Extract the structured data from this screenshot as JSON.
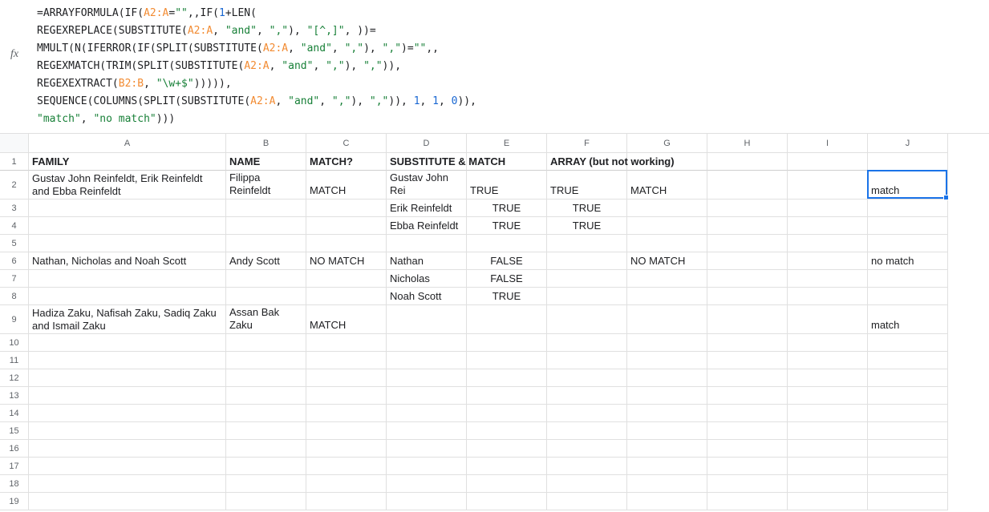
{
  "formula_lines": [
    [
      {
        "t": "punc",
        "v": "="
      },
      {
        "t": "func",
        "v": "ARRAYFORMULA"
      },
      {
        "t": "punc",
        "v": "("
      },
      {
        "t": "func",
        "v": "IF"
      },
      {
        "t": "punc",
        "v": "("
      },
      {
        "t": "range",
        "v": "A2:A"
      },
      {
        "t": "punc",
        "v": "="
      },
      {
        "t": "str",
        "v": "\"\""
      },
      {
        "t": "punc",
        "v": ",,"
      },
      {
        "t": "func",
        "v": "IF"
      },
      {
        "t": "punc",
        "v": "("
      },
      {
        "t": "num",
        "v": "1"
      },
      {
        "t": "punc",
        "v": "+"
      },
      {
        "t": "func",
        "v": "LEN"
      },
      {
        "t": "punc",
        "v": "("
      }
    ],
    [
      {
        "t": "func",
        "v": "REGEXREPLACE"
      },
      {
        "t": "punc",
        "v": "("
      },
      {
        "t": "func",
        "v": "SUBSTITUTE"
      },
      {
        "t": "punc",
        "v": "("
      },
      {
        "t": "range",
        "v": "A2:A"
      },
      {
        "t": "punc",
        "v": ", "
      },
      {
        "t": "str",
        "v": "\"and\""
      },
      {
        "t": "punc",
        "v": ", "
      },
      {
        "t": "str",
        "v": "\",\""
      },
      {
        "t": "punc",
        "v": "), "
      },
      {
        "t": "str",
        "v": "\"[^,]\""
      },
      {
        "t": "punc",
        "v": ", ))="
      }
    ],
    [
      {
        "t": "func",
        "v": "MMULT"
      },
      {
        "t": "punc",
        "v": "("
      },
      {
        "t": "func",
        "v": "N"
      },
      {
        "t": "punc",
        "v": "("
      },
      {
        "t": "func",
        "v": "IFERROR"
      },
      {
        "t": "punc",
        "v": "("
      },
      {
        "t": "func",
        "v": "IF"
      },
      {
        "t": "punc",
        "v": "("
      },
      {
        "t": "func",
        "v": "SPLIT"
      },
      {
        "t": "punc",
        "v": "("
      },
      {
        "t": "func",
        "v": "SUBSTITUTE"
      },
      {
        "t": "punc",
        "v": "("
      },
      {
        "t": "range",
        "v": "A2:A"
      },
      {
        "t": "punc",
        "v": ", "
      },
      {
        "t": "str",
        "v": "\"and\""
      },
      {
        "t": "punc",
        "v": ", "
      },
      {
        "t": "str",
        "v": "\",\""
      },
      {
        "t": "punc",
        "v": "), "
      },
      {
        "t": "str",
        "v": "\",\""
      },
      {
        "t": "punc",
        "v": ")="
      },
      {
        "t": "str",
        "v": "\"\""
      },
      {
        "t": "punc",
        "v": ",,"
      }
    ],
    [
      {
        "t": "func",
        "v": "REGEXMATCH"
      },
      {
        "t": "punc",
        "v": "("
      },
      {
        "t": "func",
        "v": "TRIM"
      },
      {
        "t": "punc",
        "v": "("
      },
      {
        "t": "func",
        "v": "SPLIT"
      },
      {
        "t": "punc",
        "v": "("
      },
      {
        "t": "func",
        "v": "SUBSTITUTE"
      },
      {
        "t": "punc",
        "v": "("
      },
      {
        "t": "range",
        "v": "A2:A"
      },
      {
        "t": "punc",
        "v": ", "
      },
      {
        "t": "str",
        "v": "\"and\""
      },
      {
        "t": "punc",
        "v": ", "
      },
      {
        "t": "str",
        "v": "\",\""
      },
      {
        "t": "punc",
        "v": "), "
      },
      {
        "t": "str",
        "v": "\",\""
      },
      {
        "t": "punc",
        "v": ")),"
      }
    ],
    [
      {
        "t": "func",
        "v": "REGEXEXTRACT"
      },
      {
        "t": "punc",
        "v": "("
      },
      {
        "t": "range",
        "v": "B2:B"
      },
      {
        "t": "punc",
        "v": ", "
      },
      {
        "t": "str",
        "v": "\"\\w+$\""
      },
      {
        "t": "punc",
        "v": "))))),"
      }
    ],
    [
      {
        "t": "func",
        "v": "SEQUENCE"
      },
      {
        "t": "punc",
        "v": "("
      },
      {
        "t": "func",
        "v": "COLUMNS"
      },
      {
        "t": "punc",
        "v": "("
      },
      {
        "t": "func",
        "v": "SPLIT"
      },
      {
        "t": "punc",
        "v": "("
      },
      {
        "t": "func",
        "v": "SUBSTITUTE"
      },
      {
        "t": "punc",
        "v": "("
      },
      {
        "t": "range",
        "v": "A2:A"
      },
      {
        "t": "punc",
        "v": ", "
      },
      {
        "t": "str",
        "v": "\"and\""
      },
      {
        "t": "punc",
        "v": ", "
      },
      {
        "t": "str",
        "v": "\",\""
      },
      {
        "t": "punc",
        "v": "), "
      },
      {
        "t": "str",
        "v": "\",\""
      },
      {
        "t": "punc",
        "v": ")), "
      },
      {
        "t": "num",
        "v": "1"
      },
      {
        "t": "punc",
        "v": ", "
      },
      {
        "t": "num",
        "v": "1"
      },
      {
        "t": "punc",
        "v": ", "
      },
      {
        "t": "num",
        "v": "0"
      },
      {
        "t": "punc",
        "v": ")),"
      }
    ],
    [
      {
        "t": "str",
        "v": "\"match\""
      },
      {
        "t": "punc",
        "v": ", "
      },
      {
        "t": "str",
        "v": "\"no match\""
      },
      {
        "t": "punc",
        "v": ")))"
      }
    ]
  ],
  "columns": [
    "A",
    "B",
    "C",
    "D",
    "E",
    "F",
    "G",
    "H",
    "I",
    "J"
  ],
  "row_numbers": [
    1,
    2,
    3,
    4,
    5,
    6,
    7,
    8,
    9,
    10,
    11,
    12,
    13,
    14,
    15,
    16,
    17,
    18,
    19
  ],
  "tall_rows": [
    2,
    9
  ],
  "headers": {
    "A": "FAMILY",
    "B": "NAME",
    "C": "MATCH?",
    "D": "SUBSTITUTE & MATCH",
    "F": "ARRAY (but not working)"
  },
  "cells": {
    "A2": "Gustav John Reinfeldt, Erik Reinfeldt and Ebba Reinfeldt",
    "B2": "Filippa Reinfeldt",
    "C2": "MATCH",
    "D2": "Gustav John Rei",
    "E2": "TRUE",
    "F2": "TRUE",
    "G2": "MATCH",
    "J2": "match",
    "D3": "Erik Reinfeldt",
    "E3": "TRUE",
    "F3": "TRUE",
    "D4": "Ebba Reinfeldt",
    "E4": "TRUE",
    "F4": "TRUE",
    "A6": "Nathan, Nicholas and Noah Scott",
    "B6": "Andy Scott",
    "C6": "NO MATCH",
    "D6": "Nathan",
    "E6": "FALSE",
    "G6": "NO MATCH",
    "J6": "no match",
    "D7": "Nicholas",
    "E7": "FALSE",
    "D8": "Noah Scott",
    "E8": "TRUE",
    "A9": "Hadiza Zaku, Nafisah Zaku, Sadiq Zaku and Ismail Zaku",
    "B9": "Assan Bak Zaku",
    "C9": "MATCH",
    "J9": "match"
  },
  "selected_cell": "J2"
}
